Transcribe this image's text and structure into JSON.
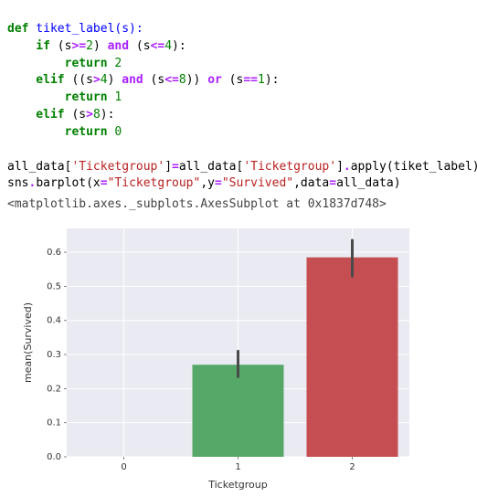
{
  "code": {
    "l1a": "def",
    "l1b": " tiket_label(s):",
    "l2a": "    if",
    "l2b": " (s",
    "l2c": ">=",
    "l2d": "2",
    "l2e": ") ",
    "l2f": "and",
    "l2g": " (s",
    "l2h": "<=",
    "l2i": "4",
    "l2j": "):",
    "l3a": "        return",
    "l3b": " ",
    "l3c": "2",
    "l4a": "    elif",
    "l4b": " ((s",
    "l4c": ">",
    "l4d": "4",
    "l4e": ") ",
    "l4f": "and",
    "l4g": " (s",
    "l4h": "<=",
    "l4i": "8",
    "l4j": ")) ",
    "l4k": "or",
    "l4l": " (s",
    "l4m": "==",
    "l4n": "1",
    "l4o": "):",
    "l5a": "        return",
    "l5b": " ",
    "l5c": "1",
    "l6a": "    elif",
    "l6b": " (s",
    "l6c": ">",
    "l6d": "8",
    "l6e": "):",
    "l7a": "        return",
    "l7b": " ",
    "l7c": "0",
    "l8": "",
    "l9a": "all_data[",
    "l9b": "'Ticketgroup'",
    "l9c": "]",
    "l9d": "=",
    "l9e": "all_data[",
    "l9f": "'Ticketgroup'",
    "l9g": "]",
    "l9h": ".",
    "l9i": "apply(tiket_label)",
    "l10a": "sns",
    "l10b": ".",
    "l10c": "barplot(x",
    "l10d": "=",
    "l10e": "\"Ticketgroup\"",
    "l10f": ",y",
    "l10g": "=",
    "l10h": "\"Survived\"",
    "l10i": ",data",
    "l10j": "=",
    "l10k": "all_data)"
  },
  "output_repr": "<matplotlib.axes._subplots.AxesSubplot at 0x1837d748>",
  "chart_data": {
    "type": "bar",
    "categories": [
      "0",
      "1",
      "2"
    ],
    "values": [
      null,
      0.27,
      0.585
    ],
    "error": [
      null,
      [
        0.235,
        0.31
      ],
      [
        0.53,
        0.635
      ]
    ],
    "colors": [
      "#4c72b0",
      "#55a868",
      "#c44e52"
    ],
    "xlabel": "Ticketgroup",
    "ylabel": "mean(Survived)",
    "yticks": [
      0.0,
      0.1,
      0.2,
      0.3,
      0.4,
      0.5,
      0.6
    ],
    "ylim": [
      0,
      0.67
    ]
  }
}
